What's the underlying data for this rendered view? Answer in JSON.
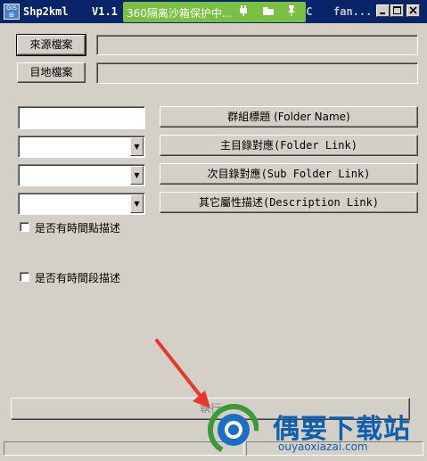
{
  "window": {
    "title": "Shp2kml",
    "version": "V1.1",
    "title_extra_1": "CC",
    "title_extra_2": "fan..."
  },
  "sandbox_badge": {
    "text": "360隔离沙箱保护中...",
    "icons": [
      "plug-icon",
      "folder-icon",
      "pin-icon"
    ]
  },
  "window_controls": [
    "minimize",
    "maximize",
    "close"
  ],
  "form": {
    "source_button": "來源檔案",
    "source_value": "",
    "target_button": "目地檔案",
    "target_value": "",
    "group_title_value": "",
    "group_title_button": "群組標題 (Folder Name)",
    "main_dir_button": "主目錄對應(Folder  Link)",
    "sub_dir_button": "次目錄對應(Sub Folder Link)",
    "other_attr_button": "其它屬性描述(Description Link)",
    "main_dir_value": "",
    "sub_dir_value": "",
    "other_attr_value": "",
    "time_point_label": "是否有時間點描述",
    "time_span_label": "是否有時間段描述",
    "run_button": "執行"
  },
  "watermark": {
    "brand": "偶要下载站",
    "url": "ouyaoxiazai.com",
    "colors": {
      "brand": "#0e5fae",
      "arrow": "#e8372b"
    }
  }
}
